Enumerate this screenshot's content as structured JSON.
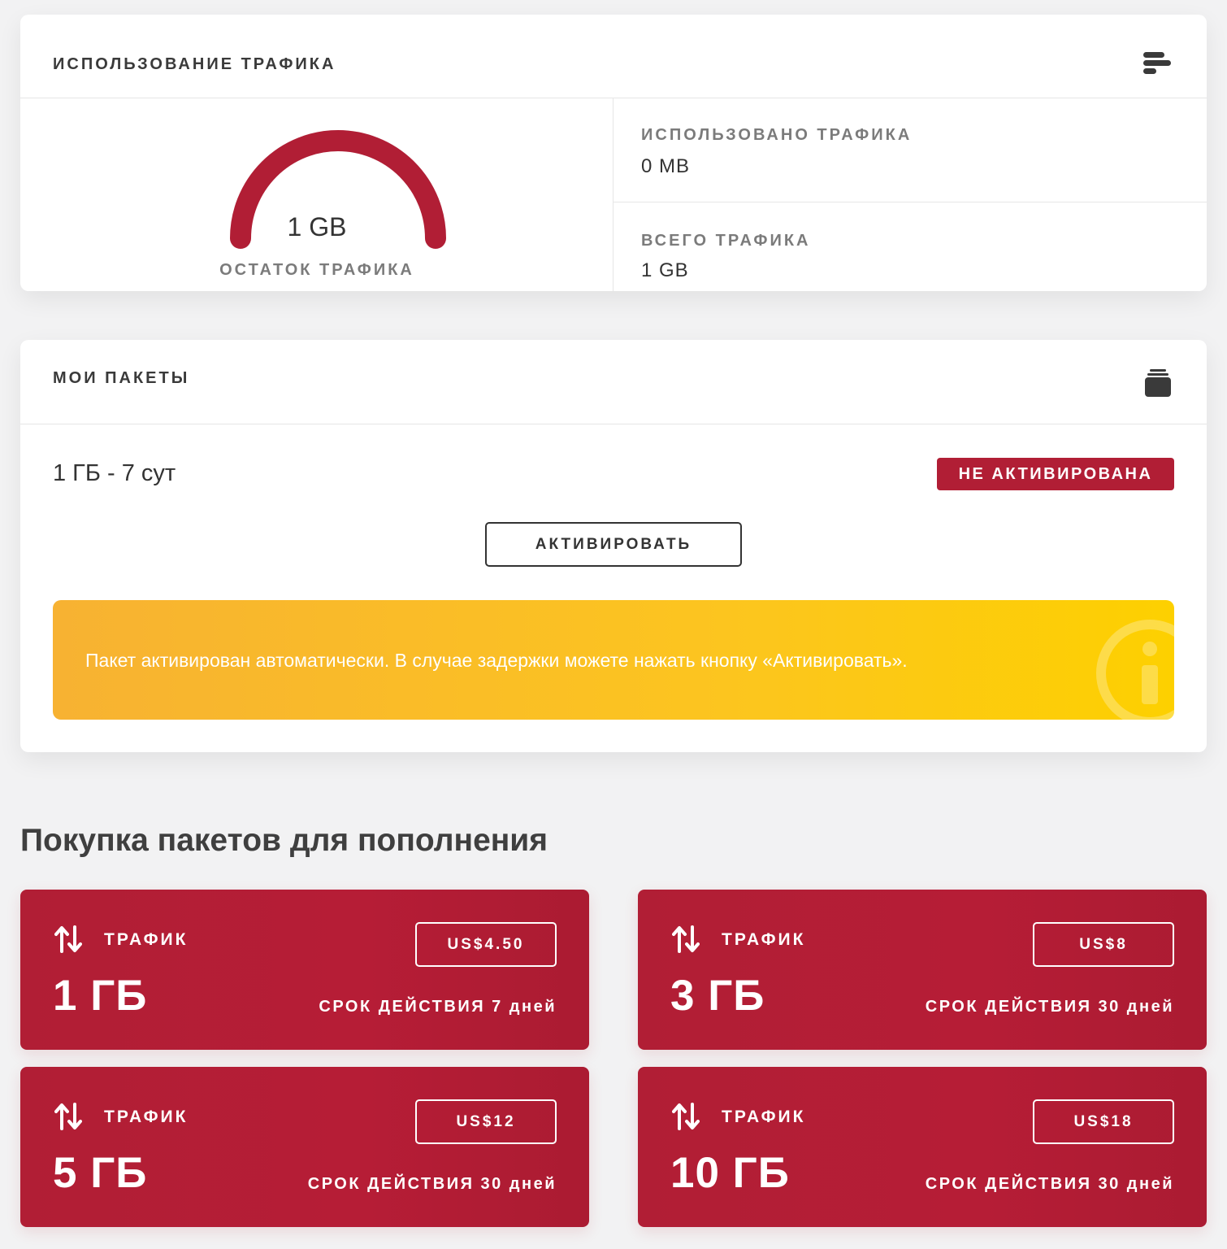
{
  "traffic": {
    "title": "ИСПОЛЬЗОВАНИЕ ТРАФИКА",
    "remaining_value": "1 GB",
    "remaining_label": "ОСТАТОК ТРАФИКА",
    "remaining_fraction": 1.0,
    "used_label": "ИСПОЛЬЗОВАНО ТРАФИКА",
    "used_value": "0 MB",
    "total_label": "ВСЕГО ТРАФИКА",
    "total_value": "1 GB",
    "icon": "bar-chart-icon"
  },
  "packages": {
    "title": "МОИ ПАКЕТЫ",
    "icon": "stack-icon",
    "item": {
      "name": "1 ГБ - 7 сут",
      "status": "НЕ АКТИВИРОВАНА"
    },
    "activate_label": "АКТИВИРОВАТЬ",
    "notice": "Пакет активирован автоматически. В случае задержки можете нажать кнопку «Активировать».",
    "notice_icon": "info-icon"
  },
  "purchase": {
    "title": "Покупка пакетов для пополнения",
    "offers": [
      {
        "type": "ТРАФИК",
        "size": "1 ГБ",
        "price": "US$4.50",
        "validity": "СРОК ДЕЙСТВИЯ 7 дней"
      },
      {
        "type": "ТРАФИК",
        "size": "3 ГБ",
        "price": "US$8",
        "validity": "СРОК ДЕЙСТВИЯ 30 дней"
      },
      {
        "type": "ТРАФИК",
        "size": "5 ГБ",
        "price": "US$12",
        "validity": "СРОК ДЕЙСТВИЯ 30 дней"
      },
      {
        "type": "ТРАФИК",
        "size": "10 ГБ",
        "price": "US$18",
        "validity": "СРОК ДЕЙСТВИЯ 30 дней"
      }
    ],
    "offer_icon": "up-down-arrows-icon"
  },
  "colors": {
    "accent": "#b11e35",
    "notice_start": "#f7b232",
    "notice_end": "#fdd000",
    "background": "#f2f2f3"
  }
}
